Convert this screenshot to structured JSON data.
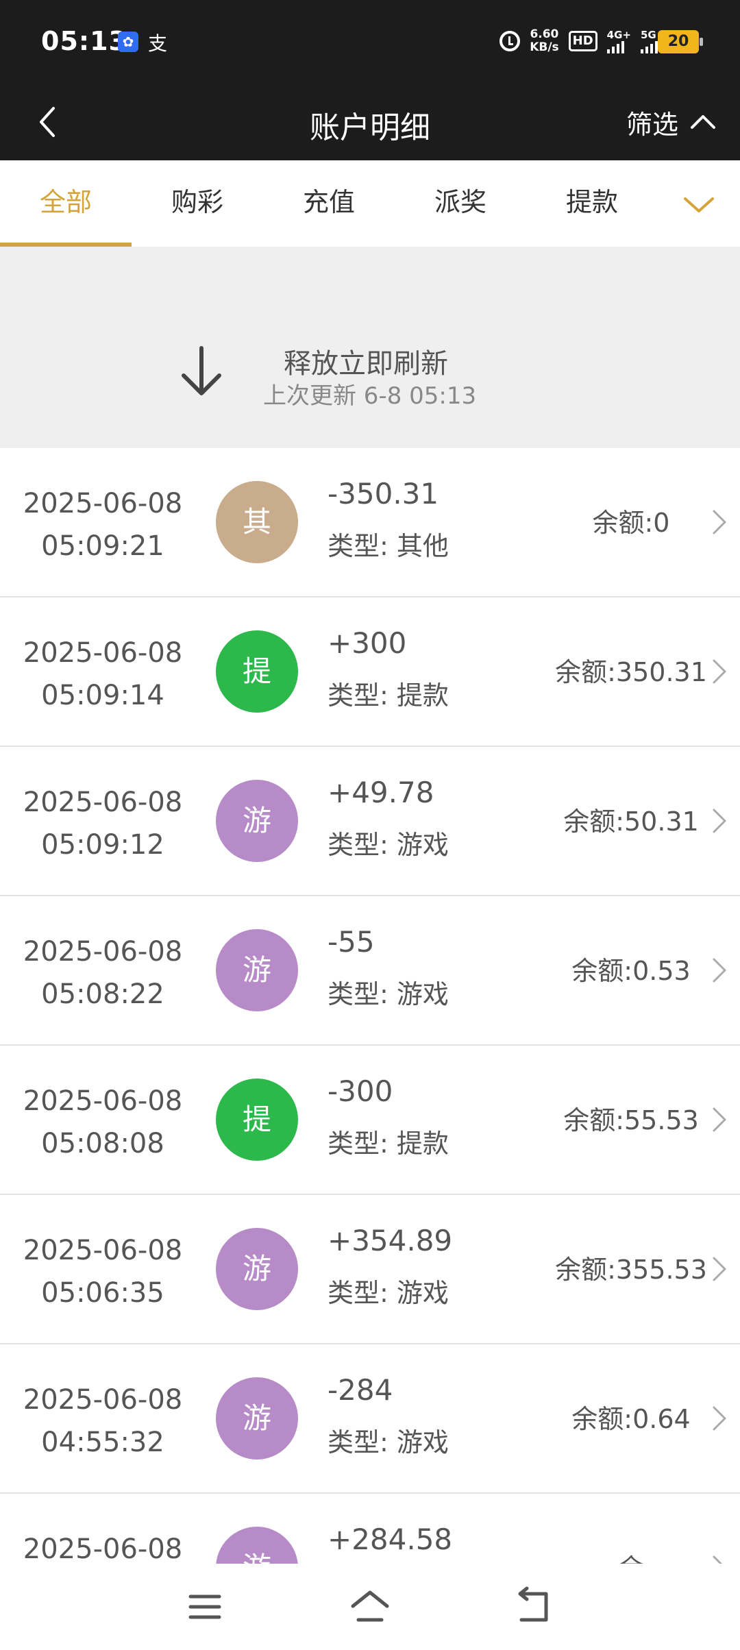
{
  "status_bar": {
    "time": "05:13",
    "app_icon_2": "支",
    "speed_value": "6.60",
    "speed_unit": "KB/s",
    "hd": "HD",
    "sim1": "4G+",
    "sim2": "5G",
    "battery": "20"
  },
  "header": {
    "title": "账户明细",
    "filter_label": "筛选"
  },
  "tabs": [
    {
      "label": "全部",
      "active": true
    },
    {
      "label": "购彩",
      "active": false
    },
    {
      "label": "充值",
      "active": false
    },
    {
      "label": "派奖",
      "active": false
    },
    {
      "label": "提款",
      "active": false
    }
  ],
  "refresh": {
    "title": "释放立即刷新",
    "subtitle": "上次更新 6-8 05:13"
  },
  "transactions": [
    {
      "date": "2025-06-08",
      "time": "05:09:21",
      "avatar": "其",
      "avatar_color": "#c9ac8b",
      "amount": "-350.31",
      "type": "类型: 其他",
      "balance": "余额:0"
    },
    {
      "date": "2025-06-08",
      "time": "05:09:14",
      "avatar": "提",
      "avatar_color": "#2cb84a",
      "amount": "+300",
      "type": "类型: 提款",
      "balance": "余额:350.31"
    },
    {
      "date": "2025-06-08",
      "time": "05:09:12",
      "avatar": "游",
      "avatar_color": "#b68bc7",
      "amount": "+49.78",
      "type": "类型: 游戏",
      "balance": "余额:50.31"
    },
    {
      "date": "2025-06-08",
      "time": "05:08:22",
      "avatar": "游",
      "avatar_color": "#b68bc7",
      "amount": "-55",
      "type": "类型: 游戏",
      "balance": "余额:0.53"
    },
    {
      "date": "2025-06-08",
      "time": "05:08:08",
      "avatar": "提",
      "avatar_color": "#2cb84a",
      "amount": "-300",
      "type": "类型: 提款",
      "balance": "余额:55.53"
    },
    {
      "date": "2025-06-08",
      "time": "05:06:35",
      "avatar": "游",
      "avatar_color": "#b68bc7",
      "amount": "+354.89",
      "type": "类型: 游戏",
      "balance": "余额:355.53"
    },
    {
      "date": "2025-06-08",
      "time": "04:55:32",
      "avatar": "游",
      "avatar_color": "#b68bc7",
      "amount": "-284",
      "type": "类型: 游戏",
      "balance": "余额:0.64"
    },
    {
      "date": "2025-06-08",
      "time": "",
      "avatar": "游",
      "avatar_color": "#b68bc7",
      "amount": "+284.58",
      "type": "",
      "balance": "余"
    }
  ],
  "icons": {
    "back": "back-icon",
    "filter_toggle": "chevron-up-icon",
    "tab_more": "chevron-down-icon",
    "refresh": "arrow-down-icon",
    "row": "chevron-right-icon",
    "nav_menu": "menu-icon",
    "nav_home": "home-icon",
    "nav_back": "return-icon"
  },
  "colors": {
    "accent": "#d4a43a",
    "header_bg": "#1c1c1c"
  }
}
